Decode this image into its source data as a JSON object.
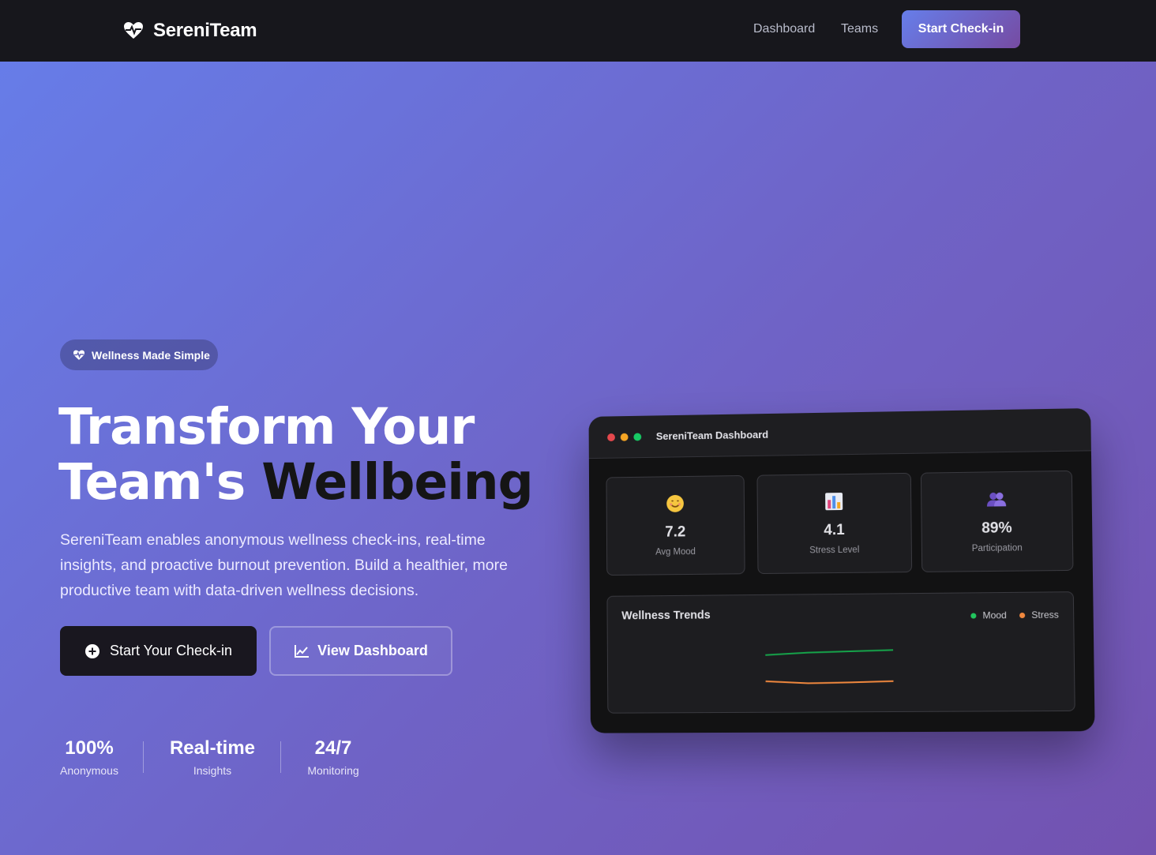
{
  "navbar": {
    "brand": "SereniTeam",
    "links": [
      "Dashboard",
      "Teams"
    ],
    "cta": "Start Check-in"
  },
  "hero": {
    "badge": "Wellness Made Simple",
    "title_line1": "Transform Your",
    "title_line2_a": "Team's ",
    "title_line2_b": "Wellbeing",
    "description": "SereniTeam enables anonymous wellness check-ins, real-time insights, and proactive burnout prevention. Build a healthier, more productive team with data-driven wellness decisions.",
    "primary_button": "Start Your Check-in",
    "secondary_button": "View Dashboard",
    "stats": [
      {
        "value": "100%",
        "label": "Anonymous"
      },
      {
        "value": "Real-time",
        "label": "Insights"
      },
      {
        "value": "24/7",
        "label": "Monitoring"
      }
    ]
  },
  "preview": {
    "title": "SereniTeam Dashboard",
    "window_dots": [
      "#e5484d",
      "#f5a524",
      "#17c964"
    ],
    "metrics": [
      {
        "icon": "smiling-face-icon",
        "value": "7.2",
        "label": "Avg Mood"
      },
      {
        "icon": "bar-chart-icon",
        "value": "4.1",
        "label": "Stress Level"
      },
      {
        "icon": "people-icon",
        "value": "89%",
        "label": "Participation"
      }
    ],
    "trends_title": "Wellness Trends",
    "legend": [
      {
        "name": "Mood",
        "color": "#22c55e"
      },
      {
        "name": "Stress",
        "color": "#f0883e"
      }
    ]
  },
  "chart_data": {
    "type": "line",
    "x": [
      1,
      2,
      3,
      4
    ],
    "series": [
      {
        "name": "Mood",
        "values": [
          6.8,
          7.0,
          7.1,
          7.2
        ],
        "color": "#16a34a"
      },
      {
        "name": "Stress",
        "values": [
          4.3,
          4.1,
          4.15,
          4.25
        ],
        "color": "#f0883e"
      }
    ],
    "ylim": [
      3.5,
      8.0
    ]
  }
}
